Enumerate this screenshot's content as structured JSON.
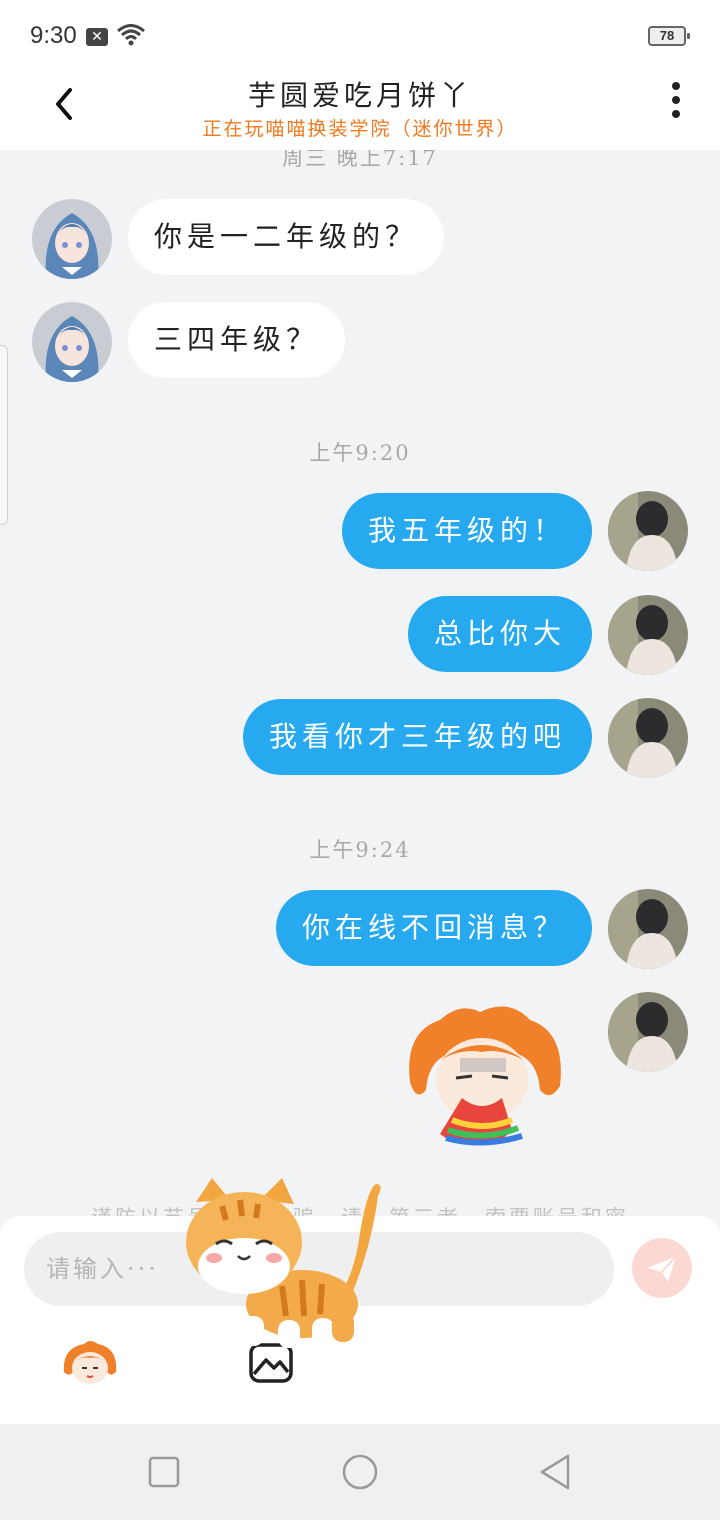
{
  "status_bar": {
    "time": "9:30",
    "battery": "78"
  },
  "header": {
    "title": "芋圆爱吃月饼丫",
    "subtitle": "正在玩喵喵换装学院（迷你世界）"
  },
  "chat": {
    "timestamps": [
      "周三 晚上7:17",
      "上午9:20",
      "上午9:24"
    ],
    "messages": [
      {
        "side": "in",
        "text": "你是一二年级的？"
      },
      {
        "side": "in",
        "text": "三四年级？"
      },
      {
        "side": "out",
        "text": "我五年级的！"
      },
      {
        "side": "out",
        "text": "总比你大"
      },
      {
        "side": "out",
        "text": "我看你才三年级的吧"
      },
      {
        "side": "out",
        "text": "你在线不回消息？"
      },
      {
        "side": "out",
        "text": "",
        "sticker": "rainbow-vomit-sticker"
      }
    ],
    "warning_partial": "谨防以艺号… …诈骗…请…第三者…索要账号和密"
  },
  "input": {
    "placeholder": "请输入···"
  },
  "colors": {
    "outgoing_bubble": "#27a9f0",
    "incoming_bubble": "#ffffff",
    "subtitle": "#f07a1e",
    "background": "#f2f3f5"
  }
}
